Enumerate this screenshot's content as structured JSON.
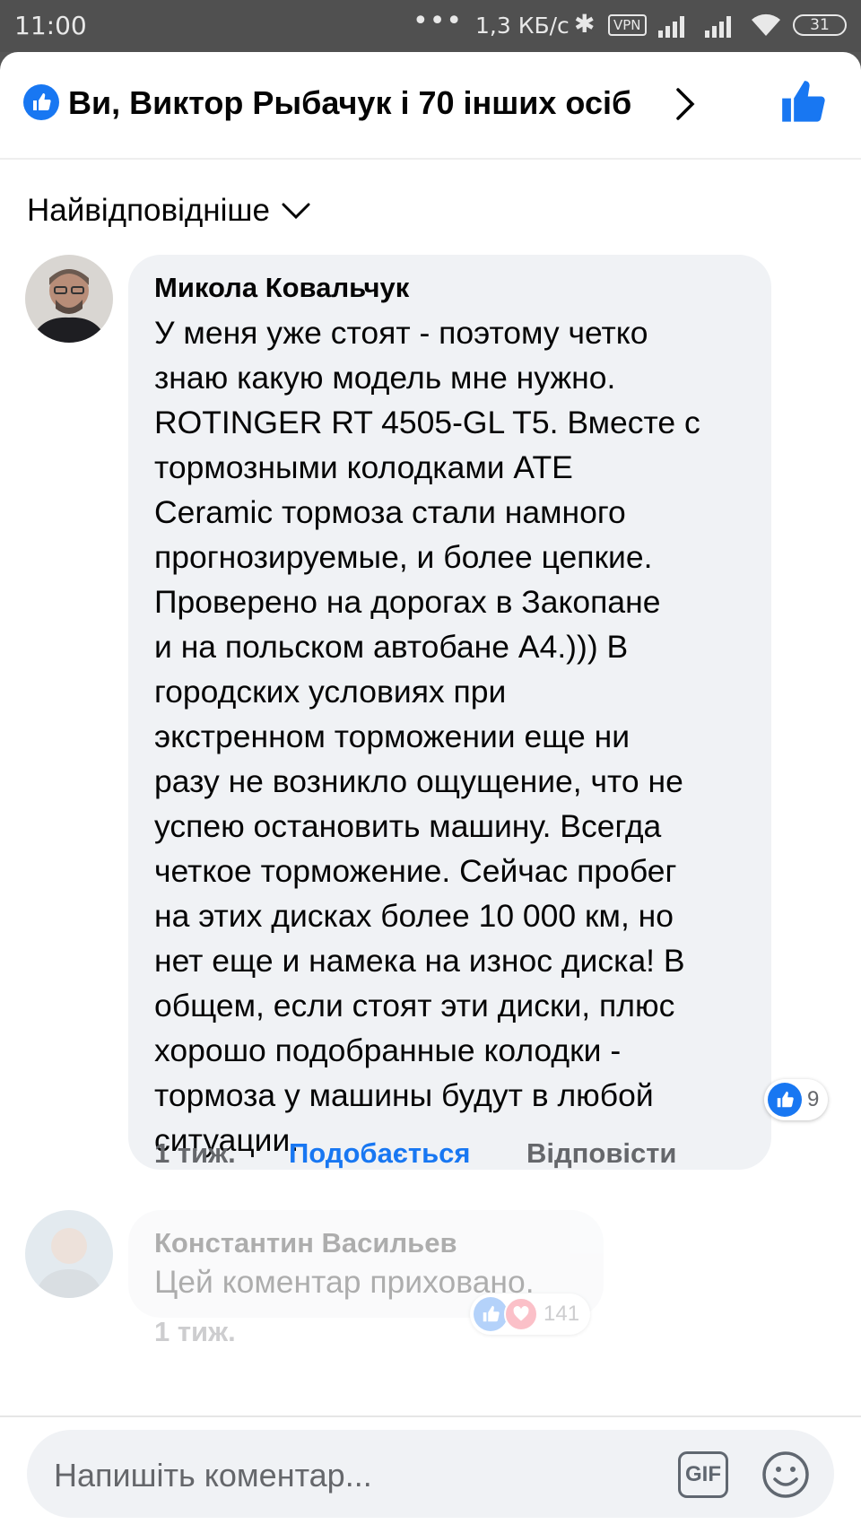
{
  "status_bar": {
    "time": "11:00",
    "dots": "•••",
    "network_speed": "1,3 КБ/с",
    "vpn": "VPN",
    "battery": "31"
  },
  "header": {
    "reactions_summary": "Ви, Виктор Рыбачук і 70 інших осіб",
    "like_icon": "thumbs-up-icon",
    "chevron_icon": "chevron-right-icon"
  },
  "sort": {
    "label": "Найвідповідніше",
    "icon": "chevron-down-icon"
  },
  "comments": [
    {
      "author": "Микола Ковальчук",
      "text": "У меня уже стоят - поэтому четко\nзнаю какую модель мне нужно.\nROTINGER RT 4505-GL T5. Вместе с\nтормозными колодками ATE\nCeramic тормоза стали намного\nпрогнозируемые, и более цепкие.\nПроверено на дорогах в  Закопане\nи на польском автобане А4.))) В\nгородских условиях при\nэкстренном торможении еще ни\nразу не возникло ощущение, что не\nуспею остановить машину. Всегда\nчеткое  торможение. Сейчас пробег\nна этих дисках более 10 000 км, но\nнет еще и намека на износ диска! В\nобщем, если стоят эти диски, плюс\nхорошо подобранные колодки -\nтормоза у машины будут в любой\nситуации.",
      "reaction_count": "9",
      "time": "1 тиж.",
      "like_label": "Подобається",
      "reply_label": "Відповісти"
    },
    {
      "author": "Константин Васильев",
      "text": "Цей коментар приховано.",
      "reaction_count": "141",
      "time": "1 тиж."
    }
  ],
  "composer": {
    "placeholder": "Напишіть коментар...",
    "gif_label": "GIF",
    "emoji_icon": "smiley-icon"
  },
  "colors": {
    "accent": "#1877f2",
    "bubble": "#f0f2f5",
    "secondary_text": "#65676b",
    "love": "#f33e58"
  }
}
